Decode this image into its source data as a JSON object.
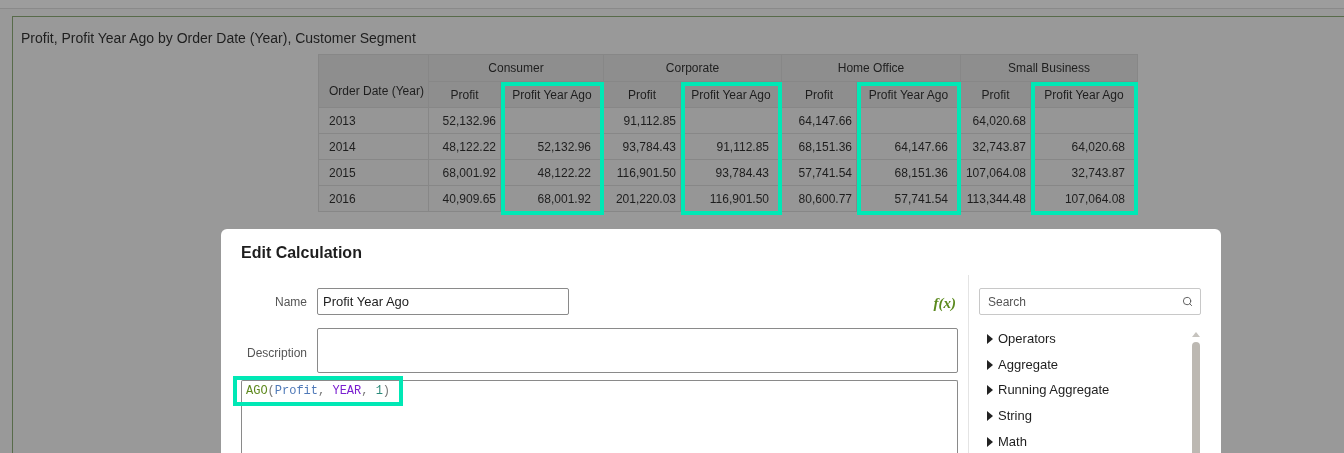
{
  "view": {
    "title": "Profit, Profit Year Ago by Order Date (Year), Customer Segment"
  },
  "table": {
    "row_header": "Order Date (Year)",
    "segments": [
      {
        "label": "Consumer",
        "measures": [
          {
            "label": "Profit",
            "kind": "profit",
            "highlighted": false
          },
          {
            "label": "Profit Year Ago",
            "kind": "profit_year_ago",
            "highlighted": true
          }
        ]
      },
      {
        "label": "Corporate",
        "measures": [
          {
            "label": "Profit",
            "kind": "profit",
            "highlighted": false
          },
          {
            "label": "Profit Year Ago",
            "kind": "profit_year_ago",
            "highlighted": true
          }
        ]
      },
      {
        "label": "Home Office",
        "measures": [
          {
            "label": "Profit",
            "kind": "profit",
            "highlighted": false
          },
          {
            "label": "Profit Year Ago",
            "kind": "profit_year_ago",
            "highlighted": true
          }
        ]
      },
      {
        "label": "Small Business",
        "measures": [
          {
            "label": "Profit",
            "kind": "profit",
            "highlighted": false
          },
          {
            "label": "Profit Year Ago",
            "kind": "profit_year_ago",
            "highlighted": true
          }
        ]
      }
    ],
    "rows": [
      {
        "year": "2013",
        "segments": [
          {
            "profit": "52,132.96"
          },
          {
            "profit": "91,112.85"
          },
          {
            "profit": "64,147.66"
          },
          {
            "profit": "64,020.68"
          }
        ]
      },
      {
        "year": "2014",
        "segments": [
          {
            "profit": "48,122.22",
            "profit_year_ago": "52,132.96"
          },
          {
            "profit": "93,784.43",
            "profit_year_ago": "91,112.85"
          },
          {
            "profit": "68,151.36",
            "profit_year_ago": "64,147.66"
          },
          {
            "profit": "32,743.87",
            "profit_year_ago": "64,020.68"
          }
        ]
      },
      {
        "year": "2015",
        "segments": [
          {
            "profit": "68,001.92",
            "profit_year_ago": "48,122.22"
          },
          {
            "profit": "116,901.50",
            "profit_year_ago": "93,784.43"
          },
          {
            "profit": "57,741.54",
            "profit_year_ago": "68,151.36"
          },
          {
            "profit": "107,064.08",
            "profit_year_ago": "32,743.87"
          }
        ]
      },
      {
        "year": "2016",
        "segments": [
          {
            "profit": "40,909.65",
            "profit_year_ago": "68,001.92"
          },
          {
            "profit": "201,220.03",
            "profit_year_ago": "116,901.50"
          },
          {
            "profit": "80,600.77",
            "profit_year_ago": "57,741.54"
          },
          {
            "profit": "113,344.48",
            "profit_year_ago": "107,064.08"
          }
        ]
      }
    ]
  },
  "dialog": {
    "title": "Edit Calculation",
    "name_label": "Name",
    "name_value": "Profit Year Ago",
    "description_label": "Description",
    "function_button": "f(x)",
    "formula": {
      "highlighted": true,
      "tokens": [
        {
          "text": "AGO",
          "kind": "function"
        },
        {
          "text": "(",
          "kind": "punct"
        },
        {
          "text": "Profit",
          "kind": "column"
        },
        {
          "text": ", ",
          "kind": "punct"
        },
        {
          "text": "YEAR",
          "kind": "keyword"
        },
        {
          "text": ", ",
          "kind": "punct"
        },
        {
          "text": "1",
          "kind": "number"
        },
        {
          "text": ")",
          "kind": "punct"
        }
      ]
    },
    "search": {
      "placeholder": "Search"
    },
    "categories": [
      {
        "label": "Operators",
        "expanded": false
      },
      {
        "label": "Aggregate",
        "expanded": false
      },
      {
        "label": "Running Aggregate",
        "expanded": false
      },
      {
        "label": "String",
        "expanded": false
      },
      {
        "label": "Math",
        "expanded": false
      }
    ]
  }
}
